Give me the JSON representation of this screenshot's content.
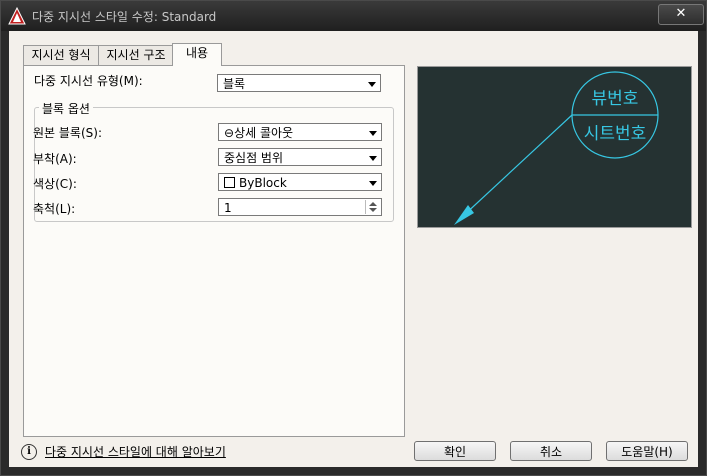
{
  "window": {
    "title": "다중 지시선 스타일 수정: Standard",
    "close_symbol": "✕"
  },
  "tabs": [
    {
      "label": "지시선 형식"
    },
    {
      "label": "지시선 구조"
    },
    {
      "label": "내용"
    }
  ],
  "content": {
    "leader_type_label": "다중 지시선 유형(M):",
    "leader_type_value": "블록",
    "block_options_title": "블록 옵션",
    "source_block_label": "원본 블록(S):",
    "source_block_value": "상세 콜아웃",
    "source_block_icon_glyph": "⊖",
    "attachment_label": "부착(A):",
    "attachment_value": "중심점 범위",
    "color_label": "색상(C):",
    "color_value": "ByBlock",
    "scale_label": "축척(L):",
    "scale_value": "1"
  },
  "preview": {
    "top_text": "뷰번호",
    "bottom_text": "시트번호",
    "line_color": "#37c7e3",
    "background_color": "#253232"
  },
  "footer": {
    "info_link": "다중 지시선 스타일에 대해 알아보기",
    "ok_label": "확인",
    "cancel_label": "취소",
    "help_label": "도움말(H)"
  },
  "icons": {
    "app": "autocad-logo-icon",
    "info": "info-icon",
    "dropdown": "chevron-down-icon",
    "spinner": "spinner-arrows-icon"
  }
}
